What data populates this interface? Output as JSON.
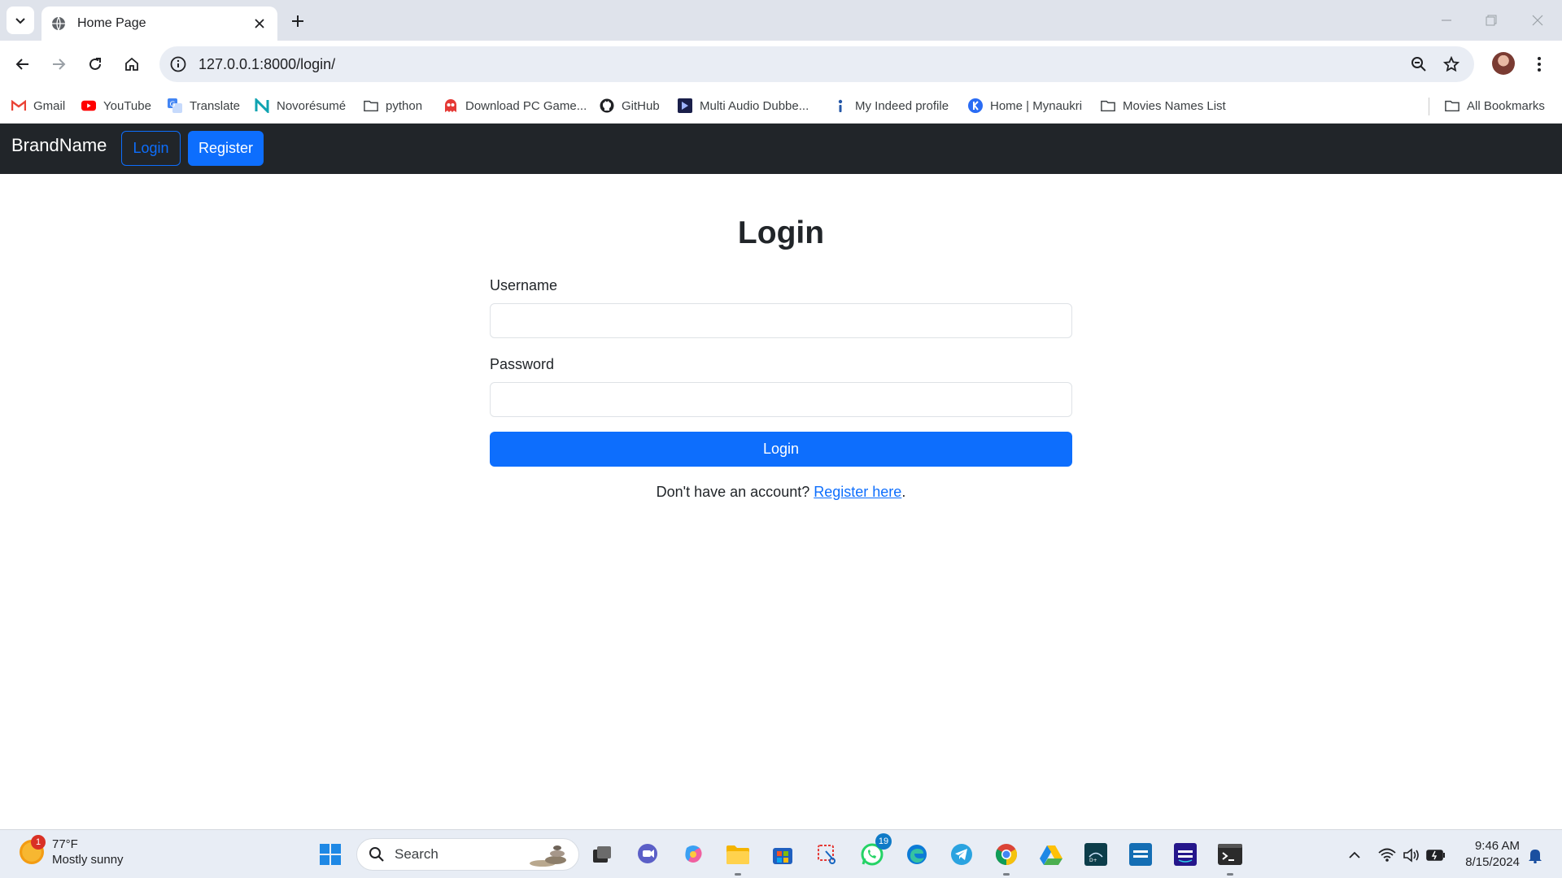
{
  "browser": {
    "tab_title": "Home Page",
    "url": "127.0.0.1:8000/login/",
    "bookmarks": [
      {
        "label": "Gmail",
        "icon": "gmail-icon"
      },
      {
        "label": "YouTube",
        "icon": "youtube-icon"
      },
      {
        "label": "Translate",
        "icon": "translate-icon"
      },
      {
        "label": "Novorésumé",
        "icon": "novoresume-icon"
      },
      {
        "label": "python",
        "icon": "folder-icon"
      },
      {
        "label": "Download PC Game...",
        "icon": "game-icon"
      },
      {
        "label": "GitHub",
        "icon": "github-icon"
      },
      {
        "label": "Multi Audio Dubbe...",
        "icon": "movie-site-icon"
      },
      {
        "label": "My Indeed profile",
        "icon": "indeed-icon"
      },
      {
        "label": "Home | Mynaukri",
        "icon": "naukri-icon"
      },
      {
        "label": "Movies Names List",
        "icon": "folder-icon"
      }
    ],
    "all_bookmarks": "All Bookmarks"
  },
  "navbar": {
    "brand": "BrandName",
    "login": "Login",
    "register": "Register"
  },
  "form": {
    "title": "Login",
    "username_label": "Username",
    "username_value": "",
    "password_label": "Password",
    "password_value": "",
    "submit": "Login",
    "register_prompt": "Don't have an account?",
    "register_link": "Register here",
    "register_suffix": "."
  },
  "taskbar": {
    "weather_temp": "77°F",
    "weather_desc": "Mostly sunny",
    "weather_badge": "1",
    "search_label": "Search",
    "whatsapp_badge": "19",
    "time": "9:46 AM",
    "date": "8/15/2024"
  },
  "colors": {
    "primary": "#0d6efd",
    "navbar": "#212529"
  }
}
